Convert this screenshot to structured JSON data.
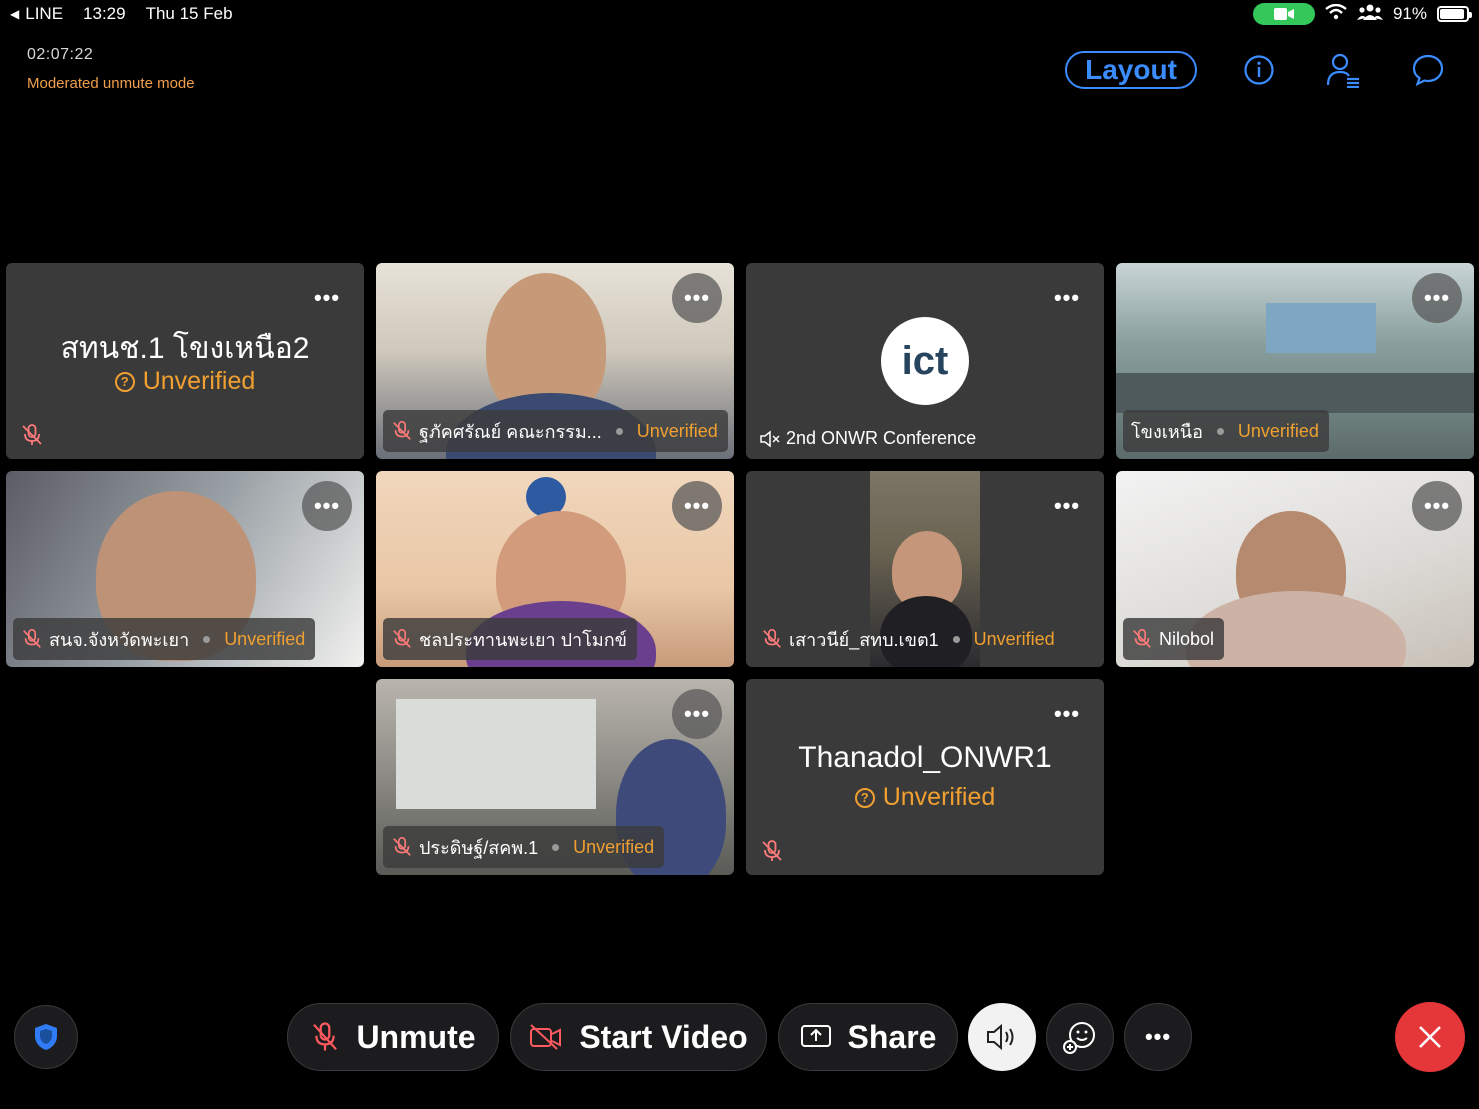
{
  "status_bar": {
    "back_app": "LINE",
    "time": "13:29",
    "date": "Thu 15 Feb",
    "battery": "91%"
  },
  "meeting": {
    "elapsed": "02:07:22",
    "mode": "Moderated unmute mode",
    "layout_label": "Layout"
  },
  "more_glyph": "•••",
  "tiles": [
    {
      "name": "สทนช.1 โขงเหนือ2",
      "status": "Unverified"
    },
    {
      "name": "ฐภัคศรัณย์ คณะกรรม...",
      "status": "Unverified"
    },
    {
      "name": "2nd ONWR Conference",
      "logo_text": "ict"
    },
    {
      "name": "โขงเหนือ",
      "status": "Unverified"
    },
    {
      "name": "สนจ.จังหวัดพะเยา",
      "status": "Unverified"
    },
    {
      "name": "ชลประทานพะเยา ปาโมกข์"
    },
    {
      "name": "เสาวนีย์_สทบ.เขต1",
      "status": "Unverified"
    },
    {
      "name": "Nilobol"
    },
    {
      "name": "ประดิษฐ์/สคพ.1",
      "status": "Unverified"
    },
    {
      "name": "Thanadol_ONWR1",
      "status": "Unverified"
    }
  ],
  "controls": {
    "unmute": "Unmute",
    "start_video": "Start Video",
    "share": "Share"
  },
  "colors": {
    "accent": "#3b8cff",
    "warning": "#f0a030",
    "mode_text": "#f0a04b",
    "end_call": "#e5363a",
    "tile_bg": "#3a3a3a"
  }
}
